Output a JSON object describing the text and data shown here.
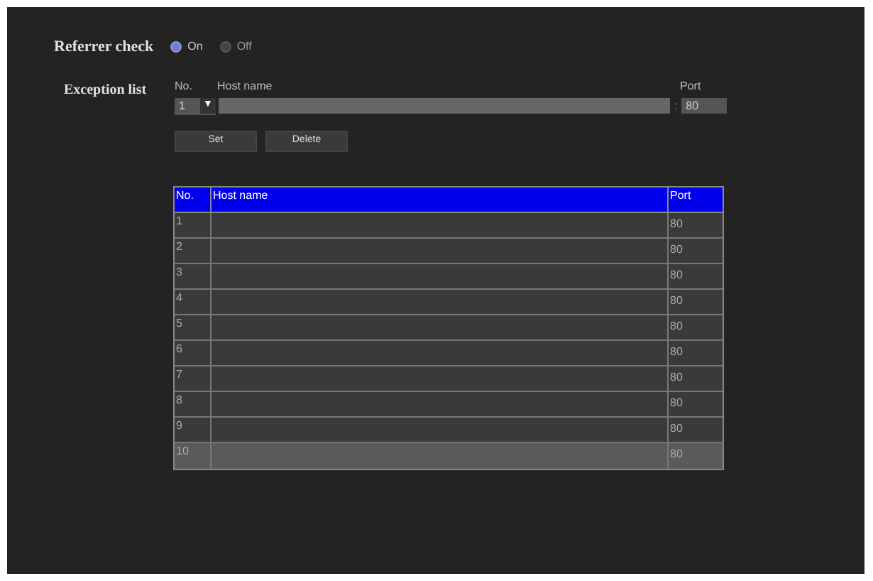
{
  "referrer_check": {
    "label": "Referrer check",
    "options": [
      {
        "label": "On",
        "selected": true
      },
      {
        "label": "Off",
        "selected": false
      }
    ]
  },
  "exception_list": {
    "label": "Exception list",
    "no_label": "No.",
    "host_label": "Host name",
    "port_label": "Port",
    "no_value": "1",
    "dropdown_arrow": "▼",
    "separator": ":",
    "port_value": "80",
    "buttons": [
      "Set",
      "Delete"
    ]
  },
  "table": {
    "columns": [
      "No.",
      "Host name",
      "Port"
    ],
    "rows": [
      {
        "no": "1",
        "port": "80",
        "selected": false
      },
      {
        "no": "2",
        "port": "80",
        "selected": false
      },
      {
        "no": "3",
        "port": "80",
        "selected": false
      },
      {
        "no": "4",
        "port": "80",
        "selected": false
      },
      {
        "no": "5",
        "port": "80",
        "selected": false
      },
      {
        "no": "6",
        "port": "80",
        "selected": false
      },
      {
        "no": "7",
        "port": "80",
        "selected": false
      },
      {
        "no": "8",
        "port": "80",
        "selected": false
      },
      {
        "no": "9",
        "port": "80",
        "selected": false
      },
      {
        "no": "10",
        "port": "80",
        "selected": true
      }
    ]
  }
}
